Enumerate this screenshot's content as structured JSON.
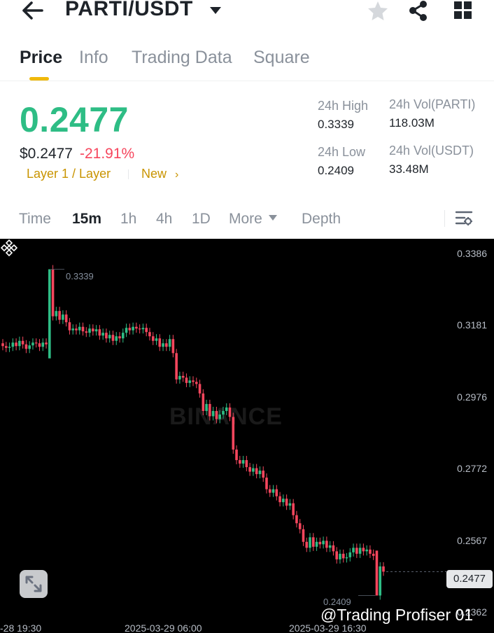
{
  "header": {
    "pair": "PARTI/USDT",
    "icons": [
      "back-arrow-icon",
      "caret-down-icon",
      "star-icon",
      "share-icon",
      "grid-icon"
    ]
  },
  "tabs": [
    "Price",
    "Info",
    "Trading Data",
    "Square"
  ],
  "ticker": {
    "last_price": "0.2477",
    "usd_price": "$0.2477",
    "change_pct": "-21.91%",
    "tag_category": "Layer 1 / Layer",
    "tag_new": "New",
    "high_label": "24h High",
    "high_value": "0.3339",
    "low_label": "24h Low",
    "low_value": "0.2409",
    "vol_base_label": "24h Vol(PARTI)",
    "vol_base_value": "118.03M",
    "vol_quote_label": "24h Vol(USDT)",
    "vol_quote_value": "33.48M"
  },
  "intervals": {
    "time": "Time",
    "m15": "15m",
    "h1": "1h",
    "h4": "4h",
    "d1": "1D",
    "more": "More",
    "depth": "Depth"
  },
  "chart": {
    "y_labels": [
      "0.3386",
      "0.3181",
      "0.2976",
      "0.2772",
      "0.2567",
      "0.2362"
    ],
    "x_labels": [
      "-28 19:30",
      "2025-03-29 06:00",
      "2025-03-29 16:30"
    ],
    "high_marker": "0.3339",
    "low_marker": "0.2409",
    "current_price": "0.2477",
    "watermark": "BINANCE",
    "credit": "@Trading Profiser 01",
    "colors": {
      "up": "#2ebd85",
      "down": "#f6465d",
      "background": "#000000"
    }
  },
  "chart_data": {
    "type": "candlestick",
    "title": "",
    "ylim": [
      0.2362,
      0.3386
    ],
    "x_labels": [
      "-28 19:30",
      "2025-03-29 06:00",
      "2025-03-29 16:30"
    ],
    "close_series": [
      0.312,
      0.3115,
      0.3118,
      0.313,
      0.312,
      0.3135,
      0.3125,
      0.3112,
      0.3122,
      0.313,
      0.3128,
      0.3118,
      0.313,
      0.3125,
      0.3339,
      0.3205,
      0.322,
      0.3195,
      0.321,
      0.3188,
      0.3165,
      0.317,
      0.3165,
      0.3175,
      0.3162,
      0.3158,
      0.317,
      0.3162,
      0.3168,
      0.315,
      0.3158,
      0.3142,
      0.3152,
      0.3135,
      0.3148,
      0.3142,
      0.3158,
      0.3172,
      0.3165,
      0.3175,
      0.317,
      0.3168,
      0.3172,
      0.316,
      0.3148,
      0.3135,
      0.3142,
      0.3118,
      0.3128,
      0.3118,
      0.314,
      0.31,
      0.3025,
      0.3035,
      0.303,
      0.3015,
      0.3022,
      0.3018,
      0.3012,
      0.2985,
      0.2935,
      0.2955,
      0.292,
      0.2935,
      0.2912,
      0.2925,
      0.2935,
      0.2945,
      0.2918,
      0.2825,
      0.2795,
      0.2785,
      0.2795,
      0.2775,
      0.2762,
      0.2772,
      0.2755,
      0.2765,
      0.2745,
      0.2712,
      0.2702,
      0.2712,
      0.2692,
      0.2675,
      0.2685,
      0.2665,
      0.2672,
      0.2638,
      0.2615,
      0.2598,
      0.2562,
      0.2545,
      0.2575,
      0.2548,
      0.2562,
      0.2555,
      0.2565,
      0.2545,
      0.2552,
      0.2535,
      0.2512,
      0.2528,
      0.2515,
      0.2518,
      0.2532,
      0.2545,
      0.2528,
      0.2545,
      0.2535,
      0.254,
      0.2528,
      0.2522,
      0.2409,
      0.2492,
      0.2477
    ]
  }
}
